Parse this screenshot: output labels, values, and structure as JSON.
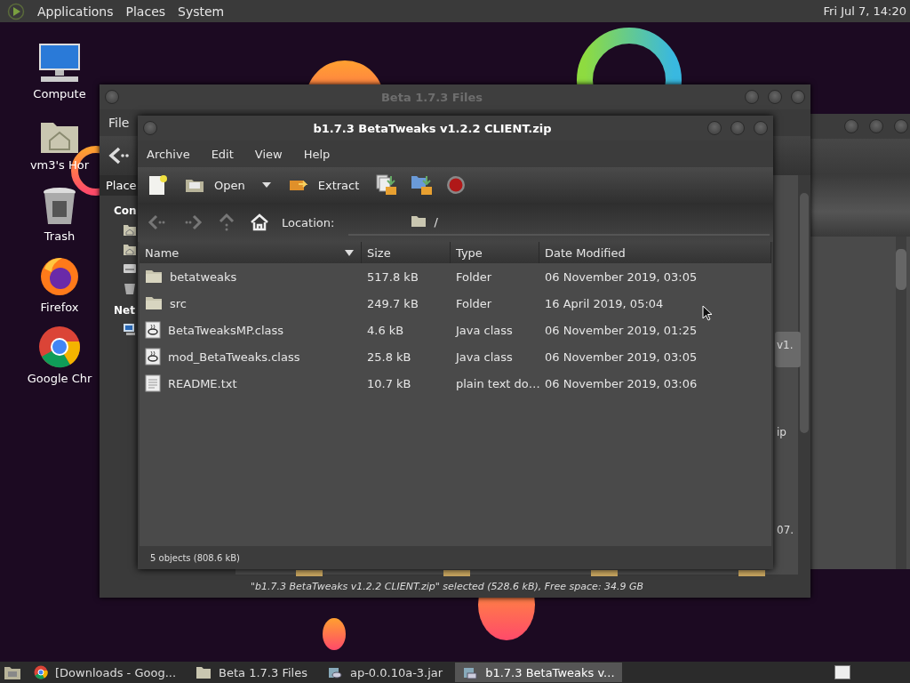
{
  "top_panel": {
    "menus": [
      "Applications",
      "Places",
      "System"
    ],
    "clock": "Fri Jul 7, 14:20"
  },
  "desktop_icons": [
    {
      "label": "Compute",
      "kind": "computer"
    },
    {
      "label": "vm3's Hor",
      "kind": "home"
    },
    {
      "label": "Trash",
      "kind": "trash"
    },
    {
      "label": "Firefox",
      "kind": "firefox"
    },
    {
      "label": "Google Chr",
      "kind": "chrome"
    }
  ],
  "files_window": {
    "title": "Beta 1.7.3 Files",
    "menus": [
      "File"
    ],
    "sidebar_tab": "Place",
    "sidebar_sections": [
      {
        "label": "Con"
      },
      {
        "label": "Net"
      }
    ],
    "partial_labels": [
      {
        "text": "v1.",
        "selected": true
      },
      {
        "text": "ip",
        "selected": false
      },
      {
        "text": "07.",
        "selected": false
      }
    ],
    "status": "\"b1.7.3 BetaTweaks v1.2.2 CLIENT.zip\" selected (528.6 kB), Free space: 34.9 GB"
  },
  "archive_window": {
    "title": "b1.7.3 BetaTweaks v1.2.2 CLIENT.zip",
    "menus": [
      "Archive",
      "Edit",
      "View",
      "Help"
    ],
    "toolbar": [
      {
        "kind": "new"
      },
      {
        "kind": "open",
        "label": "Open"
      },
      {
        "kind": "extract",
        "label": "Extract"
      },
      {
        "kind": "add-files"
      },
      {
        "kind": "add-folder"
      },
      {
        "kind": "stop"
      }
    ],
    "location_label": "Location:",
    "path": "/",
    "columns": [
      {
        "label": "Name",
        "sorted": true
      },
      {
        "label": "Size",
        "sorted": false
      },
      {
        "label": "Type",
        "sorted": false
      },
      {
        "label": "Date Modified",
        "sorted": false
      }
    ],
    "rows": [
      {
        "name": "betatweaks",
        "size": "517.8 kB",
        "type": "Folder",
        "date": "06 November 2019, 03:05",
        "kind": "folder"
      },
      {
        "name": "src",
        "size": "249.7 kB",
        "type": "Folder",
        "date": "16 April 2019, 05:04",
        "kind": "folder"
      },
      {
        "name": "BetaTweaksMP.class",
        "size": "4.6 kB",
        "type": "Java class",
        "date": "06 November 2019, 01:25",
        "kind": "java"
      },
      {
        "name": "mod_BetaTweaks.class",
        "size": "25.8 kB",
        "type": "Java class",
        "date": "06 November 2019, 03:05",
        "kind": "java"
      },
      {
        "name": "README.txt",
        "size": "10.7 kB",
        "type": "plain text do…",
        "date": "06 November 2019, 03:06",
        "kind": "text"
      }
    ],
    "status": "5 objects (808.6 kB)"
  },
  "taskbar": [
    {
      "label": "[Downloads - Goog...",
      "kind": "chrome",
      "selected": false
    },
    {
      "label": "Beta 1.7.3 Files",
      "kind": "folder",
      "selected": false
    },
    {
      "label": "ap-0.0.10a-3.jar",
      "kind": "java",
      "selected": false
    },
    {
      "label": "b1.7.3 BetaTweaks v...",
      "kind": "archive",
      "selected": true
    }
  ]
}
